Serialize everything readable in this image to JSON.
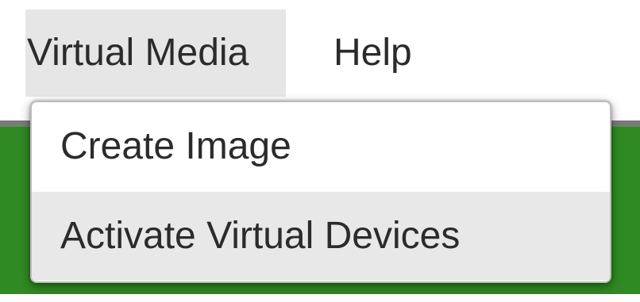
{
  "menubar": {
    "items": [
      {
        "label": "Virtual Media"
      },
      {
        "label": "Help"
      }
    ]
  },
  "dropdown": {
    "items": [
      {
        "label": "Create Image",
        "highlighted": false
      },
      {
        "label": "Activate Virtual Devices",
        "highlighted": true
      }
    ]
  },
  "colors": {
    "menu_open_bg": "#e6e6e6",
    "hover_bg": "#e8e8e8",
    "background_green": "#2f8a23",
    "text": "#2b2b2b"
  }
}
